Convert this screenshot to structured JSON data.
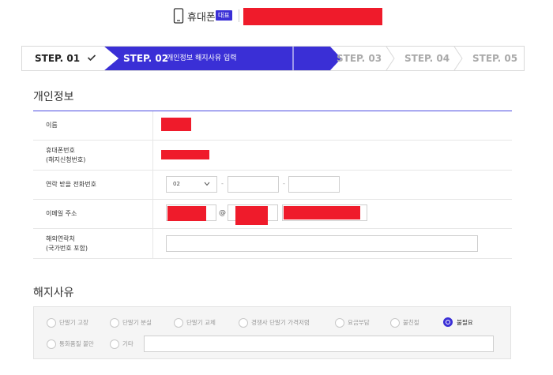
{
  "header": {
    "phone_icon": "mobile-phone-icon",
    "phone_label": "휴대폰",
    "rep_badge": "대표"
  },
  "steps": [
    {
      "label": "STEP. 01",
      "state": "done"
    },
    {
      "label": "STEP. 02",
      "desc": "개인정보 해지사유 입력",
      "state": "active"
    },
    {
      "label": "STEP. 03",
      "state": "pending"
    },
    {
      "label": "STEP. 04",
      "state": "pending"
    },
    {
      "label": "STEP. 05",
      "state": "pending"
    }
  ],
  "personal": {
    "title": "개인정보",
    "name_label": "이름",
    "phone_label_1": "휴대폰번호",
    "phone_label_2": "(해지신청번호)",
    "contact_label": "연락 받을 전화번호",
    "contact_area": "02",
    "contact_dash": "-",
    "email_label": "이메일 주소",
    "email_at": "@",
    "overseas_label_1": "해외연락처",
    "overseas_label_2": "(국가번호 포함)"
  },
  "reason": {
    "title": "해지사유",
    "options": [
      {
        "label": "단말기 고장",
        "checked": false
      },
      {
        "label": "단말기 분실",
        "checked": false
      },
      {
        "label": "단말기 교체",
        "checked": false
      },
      {
        "label": "경쟁사 단말기 가격저렴",
        "checked": false
      },
      {
        "label": "요금부담",
        "checked": false
      },
      {
        "label": "불친절",
        "checked": false
      },
      {
        "label": "불필요",
        "checked": true
      },
      {
        "label": "통화품질 불만",
        "checked": false
      },
      {
        "label": "기타",
        "checked": false
      }
    ]
  },
  "colors": {
    "accent": "#3a2fd6",
    "redaction": "#ef1b2b"
  }
}
